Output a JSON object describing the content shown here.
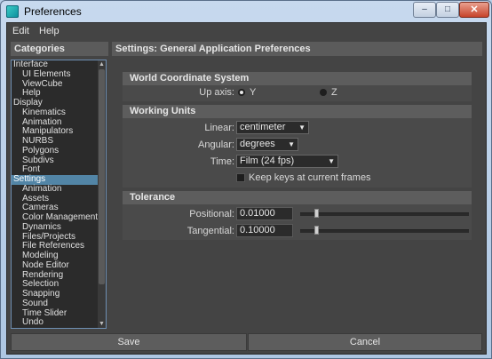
{
  "window": {
    "title": "Preferences"
  },
  "window_buttons": {
    "minimize": "–",
    "maximize": "□",
    "close": "✕"
  },
  "menu": {
    "items": [
      "Edit",
      "Help"
    ]
  },
  "left_panel": {
    "header": "Categories"
  },
  "categories": [
    {
      "label": "Interface",
      "level": "top"
    },
    {
      "label": "UI Elements",
      "level": "sub"
    },
    {
      "label": "ViewCube",
      "level": "sub"
    },
    {
      "label": "Help",
      "level": "sub"
    },
    {
      "label": "Display",
      "level": "top"
    },
    {
      "label": "Kinematics",
      "level": "sub"
    },
    {
      "label": "Animation",
      "level": "sub"
    },
    {
      "label": "Manipulators",
      "level": "sub"
    },
    {
      "label": "NURBS",
      "level": "sub"
    },
    {
      "label": "Polygons",
      "level": "sub"
    },
    {
      "label": "Subdivs",
      "level": "sub"
    },
    {
      "label": "Font",
      "level": "sub"
    },
    {
      "label": "Settings",
      "level": "top",
      "selected": true
    },
    {
      "label": "Animation",
      "level": "sub"
    },
    {
      "label": "Assets",
      "level": "sub"
    },
    {
      "label": "Cameras",
      "level": "sub"
    },
    {
      "label": "Color Management",
      "level": "sub"
    },
    {
      "label": "Dynamics",
      "level": "sub"
    },
    {
      "label": "Files/Projects",
      "level": "sub"
    },
    {
      "label": "File References",
      "level": "sub"
    },
    {
      "label": "Modeling",
      "level": "sub"
    },
    {
      "label": "Node Editor",
      "level": "sub"
    },
    {
      "label": "Rendering",
      "level": "sub"
    },
    {
      "label": "Selection",
      "level": "sub"
    },
    {
      "label": "Snapping",
      "level": "sub"
    },
    {
      "label": "Sound",
      "level": "sub"
    },
    {
      "label": "Time Slider",
      "level": "sub"
    },
    {
      "label": "Undo",
      "level": "sub"
    }
  ],
  "right_panel": {
    "header": "Settings: General Application Preferences"
  },
  "world_coordinate": {
    "title": "World Coordinate System",
    "up_axis_label": "Up axis:",
    "options": [
      "Y",
      "Z"
    ],
    "selected": "Y"
  },
  "working_units": {
    "title": "Working Units",
    "linear_label": "Linear:",
    "linear_value": "centimeter",
    "angular_label": "Angular:",
    "angular_value": "degrees",
    "time_label": "Time:",
    "time_value": "Film (24 fps)",
    "keep_keys_label": "Keep keys at current frames",
    "keep_keys_checked": false
  },
  "tolerance": {
    "title": "Tolerance",
    "positional_label": "Positional:",
    "positional_value": "0.01000",
    "positional_slider": 0.01,
    "tangential_label": "Tangential:",
    "tangential_value": "0.10000",
    "tangential_slider": 0.01
  },
  "buttons": {
    "save": "Save",
    "cancel": "Cancel"
  },
  "colors": {
    "accent": "#5285a6",
    "panel": "#444444",
    "section": "#5d5d5d"
  },
  "icons": {
    "app": "maya-app-icon",
    "dropdown": "chevron-down-icon"
  }
}
